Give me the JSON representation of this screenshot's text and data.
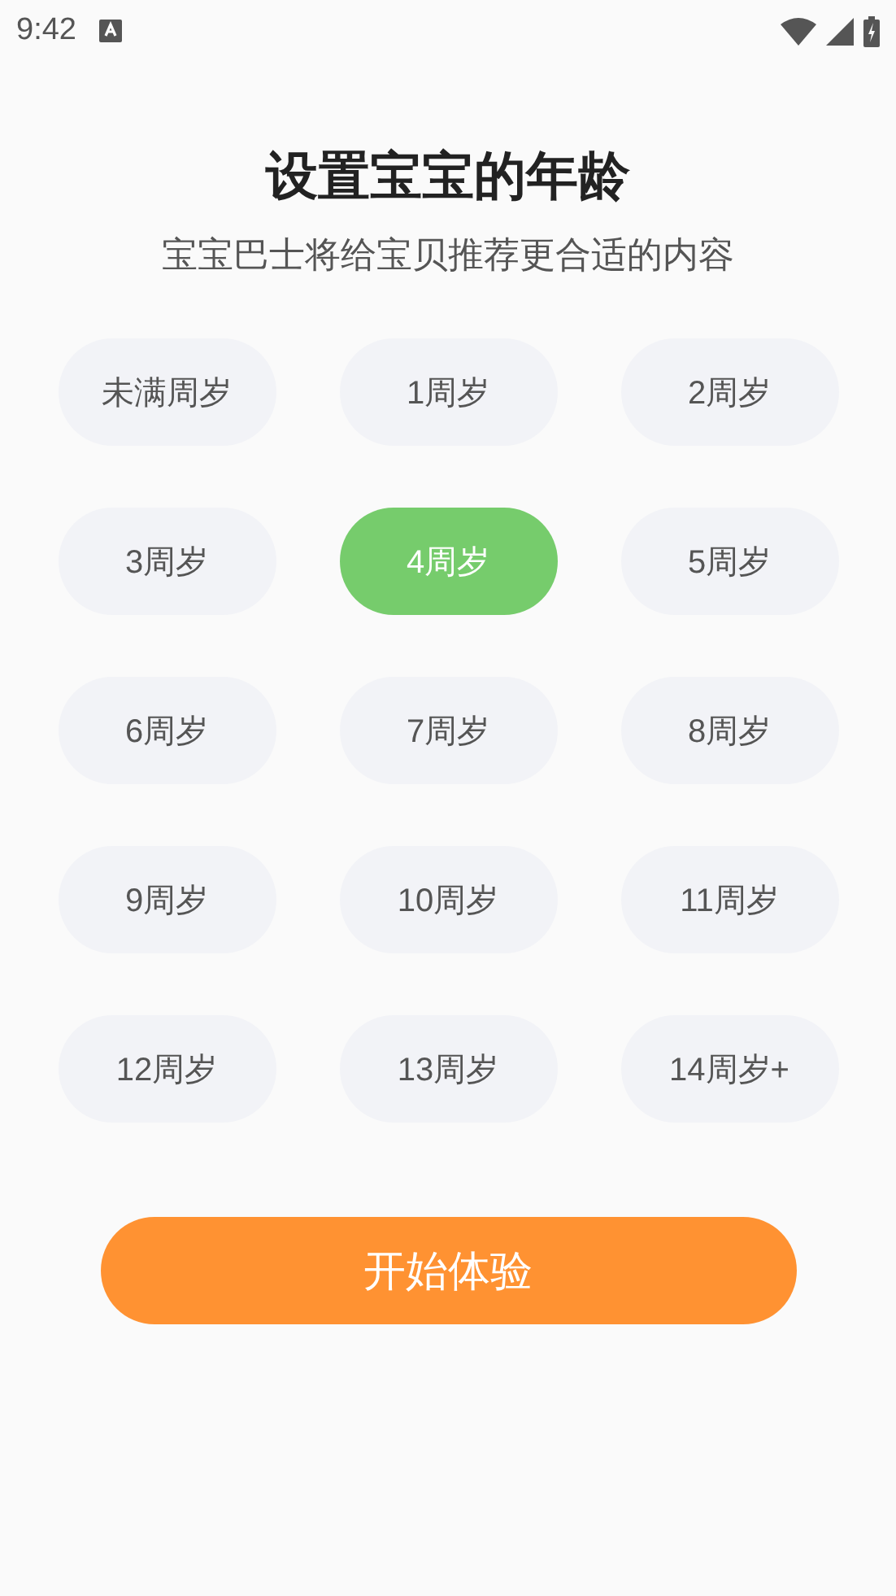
{
  "status_bar": {
    "time": "9:42"
  },
  "title": "设置宝宝的年龄",
  "subtitle": "宝宝巴士将给宝贝推荐更合适的内容",
  "ages": [
    {
      "label": "未满周岁",
      "selected": false
    },
    {
      "label": "1周岁",
      "selected": false
    },
    {
      "label": "2周岁",
      "selected": false
    },
    {
      "label": "3周岁",
      "selected": false
    },
    {
      "label": "4周岁",
      "selected": true
    },
    {
      "label": "5周岁",
      "selected": false
    },
    {
      "label": "6周岁",
      "selected": false
    },
    {
      "label": "7周岁",
      "selected": false
    },
    {
      "label": "8周岁",
      "selected": false
    },
    {
      "label": "9周岁",
      "selected": false
    },
    {
      "label": "10周岁",
      "selected": false
    },
    {
      "label": "11周岁",
      "selected": false
    },
    {
      "label": "12周岁",
      "selected": false
    },
    {
      "label": "13周岁",
      "selected": false
    },
    {
      "label": "14周岁+",
      "selected": false
    }
  ],
  "start_button": "开始体验"
}
